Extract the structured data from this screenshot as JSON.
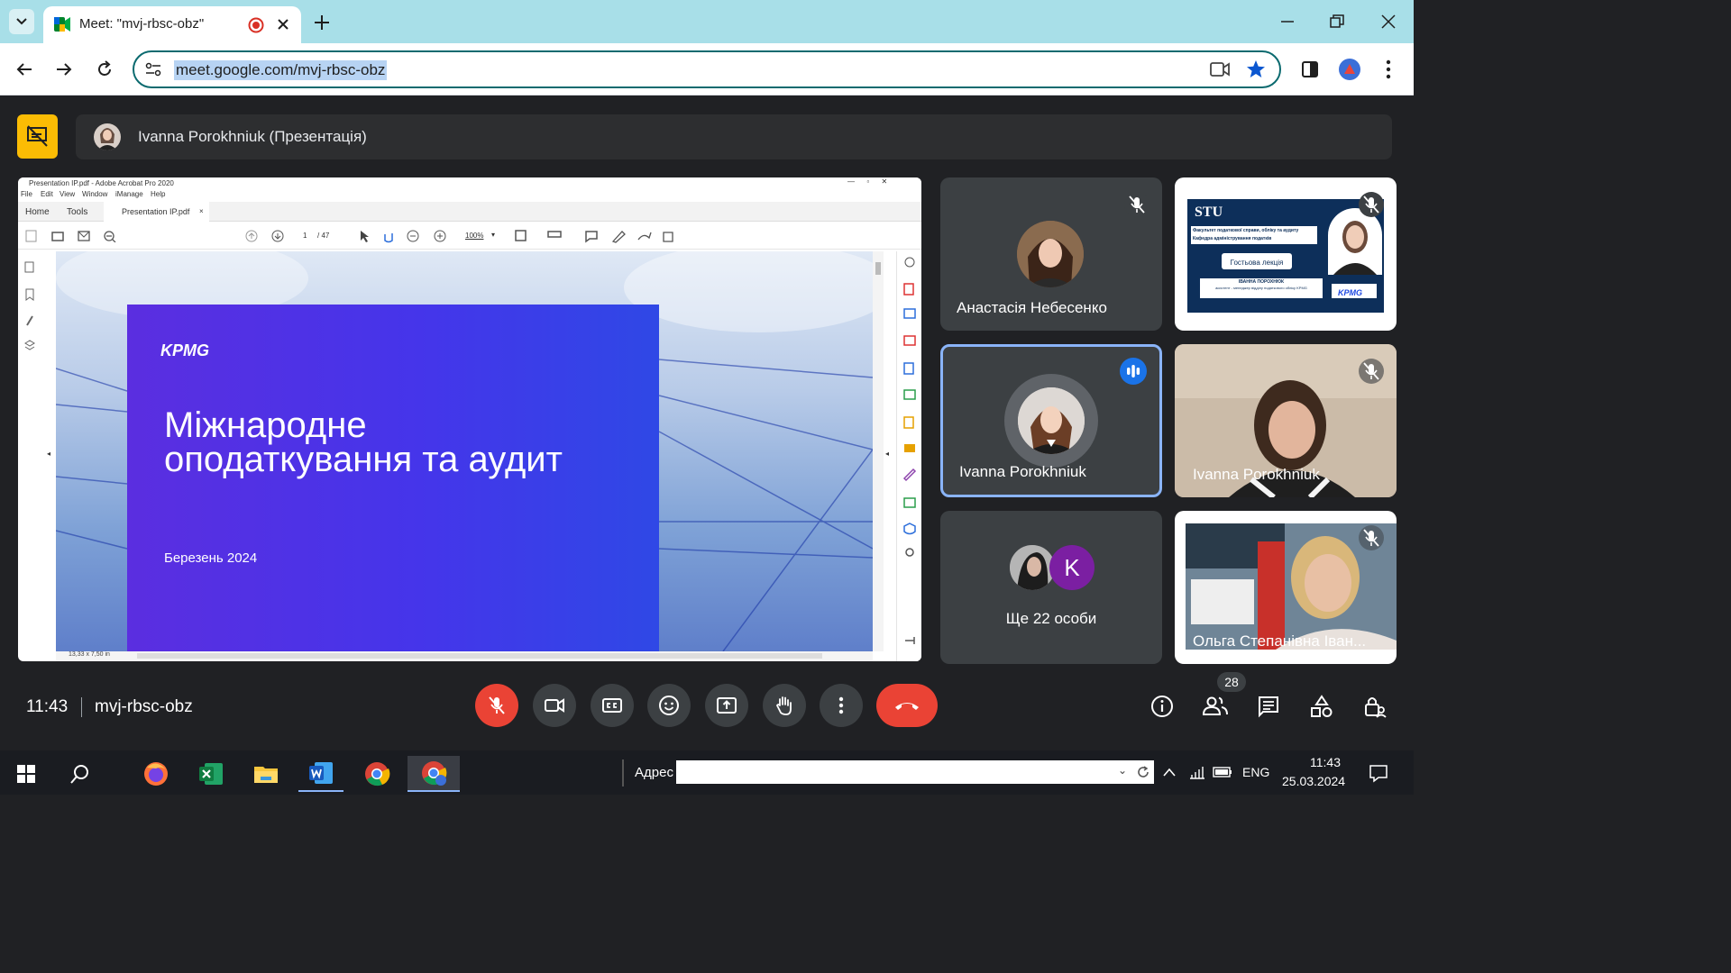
{
  "browser": {
    "tab_title": "Meet: \"mvj-rbsc-obz\"",
    "url": "meet.google.com/mvj-rbsc-obz"
  },
  "meet": {
    "presenter_banner": "Ivanna Porokhniuk (Презентація)",
    "meeting_time": "11:43",
    "meeting_code": "mvj-rbsc-obz",
    "participant_count": "28"
  },
  "acrobat": {
    "window_title": "Presentation IP.pdf - Adobe Acrobat Pro 2020",
    "menu": [
      "File",
      "Edit",
      "View",
      "Window",
      "iManage",
      "Help"
    ],
    "tabs": [
      "Home",
      "Tools",
      "Presentation IP.pdf"
    ],
    "page_current": "1",
    "page_total": "/ 47",
    "zoom": "100%",
    "page_size": "13,33 x 7,50 in"
  },
  "slide": {
    "logo": "KPMG",
    "title_line1": "Міжнародне",
    "title_line2": "оподаткування та аудит",
    "date": "Березень 2024"
  },
  "tiles": [
    {
      "name": "Анастасія Небесенко",
      "muted": true
    },
    {
      "name": "Кафедра адмініструва...",
      "muted": true
    },
    {
      "name": "Ivanna Porokhniuk",
      "speaking": true
    },
    {
      "name": "Ivanna Porokhniuk",
      "muted": true
    },
    {
      "name": "Ще 22 особи",
      "avatar_letter": "K"
    },
    {
      "name": "Ольга Степанівна Іван...",
      "muted": true
    }
  ],
  "shared_slide_thumb": {
    "logo": "STU",
    "line1": "Факультет податкової справи, обліку та аудиту",
    "line2": "Кафедра адміністрування податків",
    "badge": "Гостьова лекція",
    "name": "ІВАННА ПОРОХНЮК",
    "sub": "асистент - менеджер відділу податкового обліку KPMG",
    "brand": "KPMG"
  },
  "taskbar": {
    "address_label": "Адрес",
    "lang": "ENG",
    "time": "11:43",
    "date": "25.03.2024"
  },
  "colors": {
    "tab_bar": "#a8dfe8",
    "omnibox_border": "#0b6a6f",
    "meet_bg": "#202124",
    "tile_bg": "#3c4043",
    "end_call": "#ea4335",
    "mic_off": "#ea4335",
    "present_icon_bg": "#fbbc04",
    "speaking_blue": "#8ab4f8"
  }
}
